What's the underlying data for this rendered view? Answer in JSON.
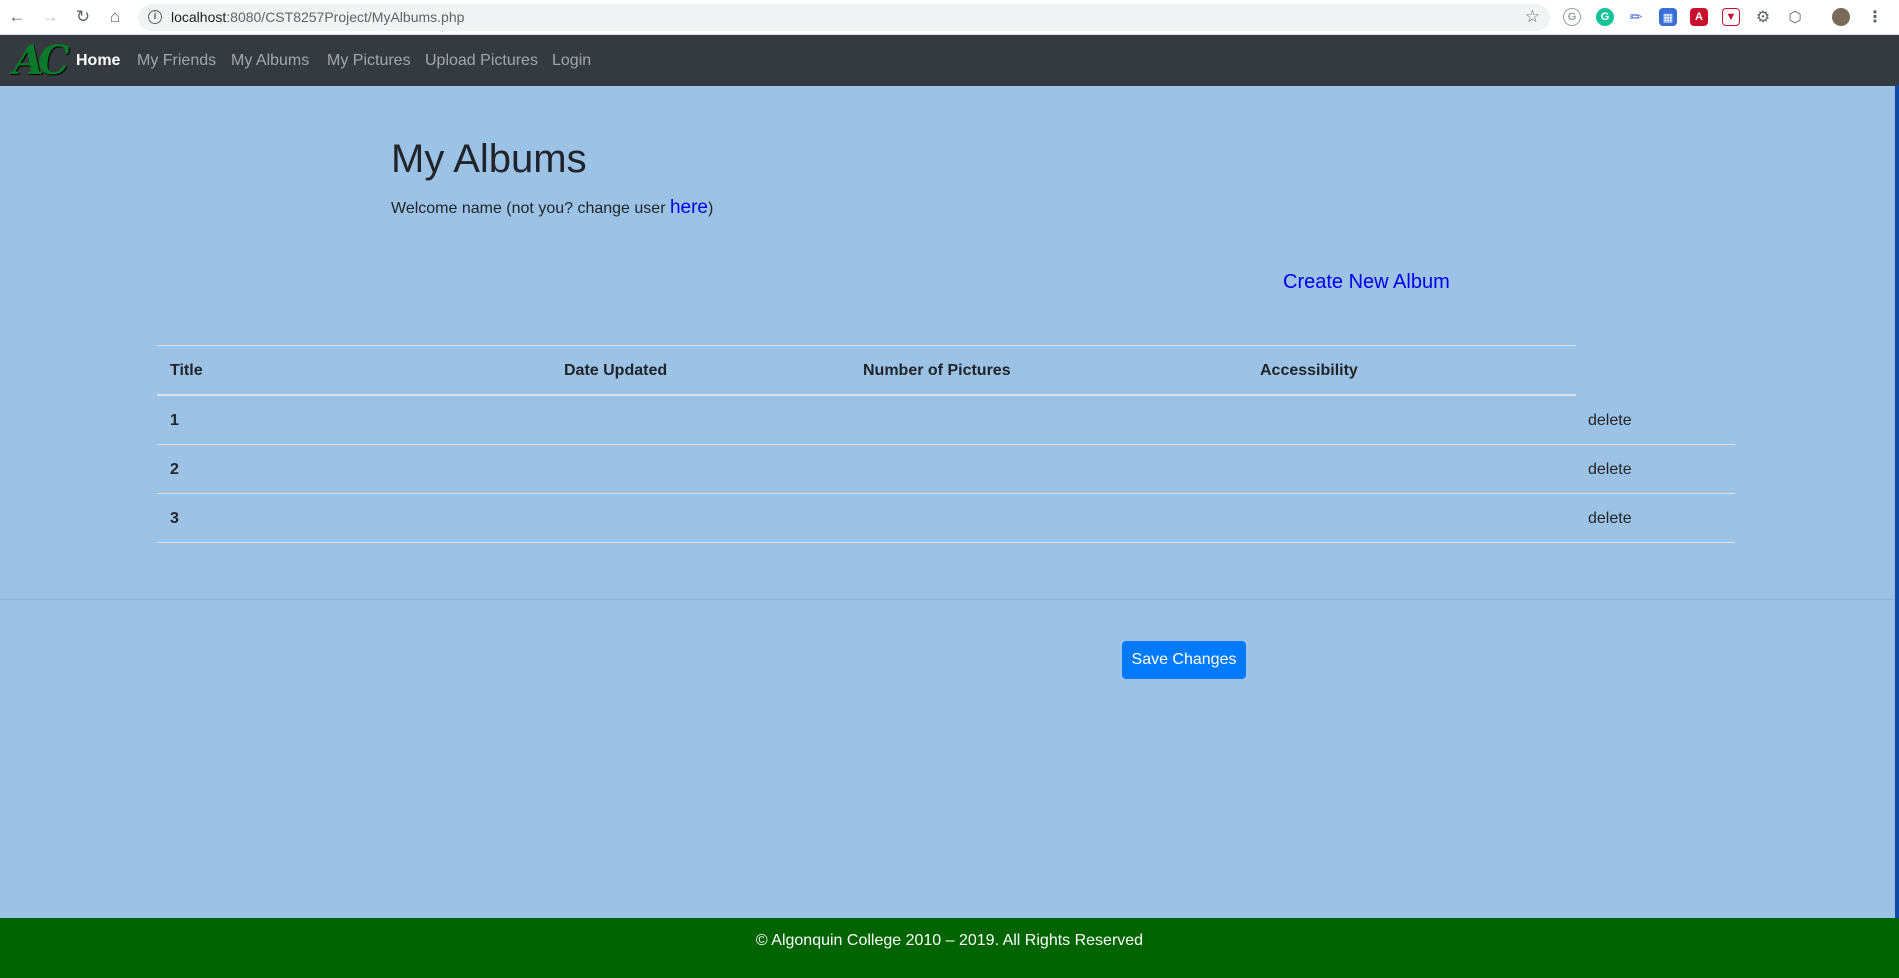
{
  "browser": {
    "url_host": "localhost",
    "url_path": ":8080/CST8257Project/MyAlbums.php",
    "back_icon": "arrow-left-icon",
    "forward_icon": "arrow-right-icon",
    "reload_icon": "reload-icon",
    "home_icon": "home-icon",
    "info_icon": "info-icon",
    "star_icon": "star-icon"
  },
  "navbar": {
    "logo": "AC",
    "items": [
      {
        "label": "Home",
        "active": true
      },
      {
        "label": "My Friends",
        "active": false
      },
      {
        "label": "My Albums",
        "active": false
      },
      {
        "label": "My Pictures",
        "active": false
      },
      {
        "label": "Upload Pictures",
        "active": false
      },
      {
        "label": "Login",
        "active": false
      }
    ]
  },
  "main": {
    "title": "My Albums",
    "welcome_prefix": "Welcome name (not you? change user ",
    "welcome_link": "here",
    "welcome_suffix": ")",
    "create_link": "Create New Album"
  },
  "table": {
    "headers": [
      "Title",
      "Date Updated",
      "Number of Pictures",
      "Accessibility"
    ],
    "rows": [
      {
        "title": "1",
        "action": "delete"
      },
      {
        "title": "2",
        "action": "delete"
      },
      {
        "title": "3",
        "action": "delete"
      }
    ]
  },
  "actions": {
    "save_label": "Save Changes"
  },
  "footer": {
    "text": "© Algonquin College 2010 – 2019. All Rights Reserved"
  },
  "colors": {
    "page_bg": "#9cc2e5",
    "navbar_bg": "#343a40",
    "footer_bg": "#006400",
    "primary": "#007bff",
    "link": "#0000ee"
  }
}
